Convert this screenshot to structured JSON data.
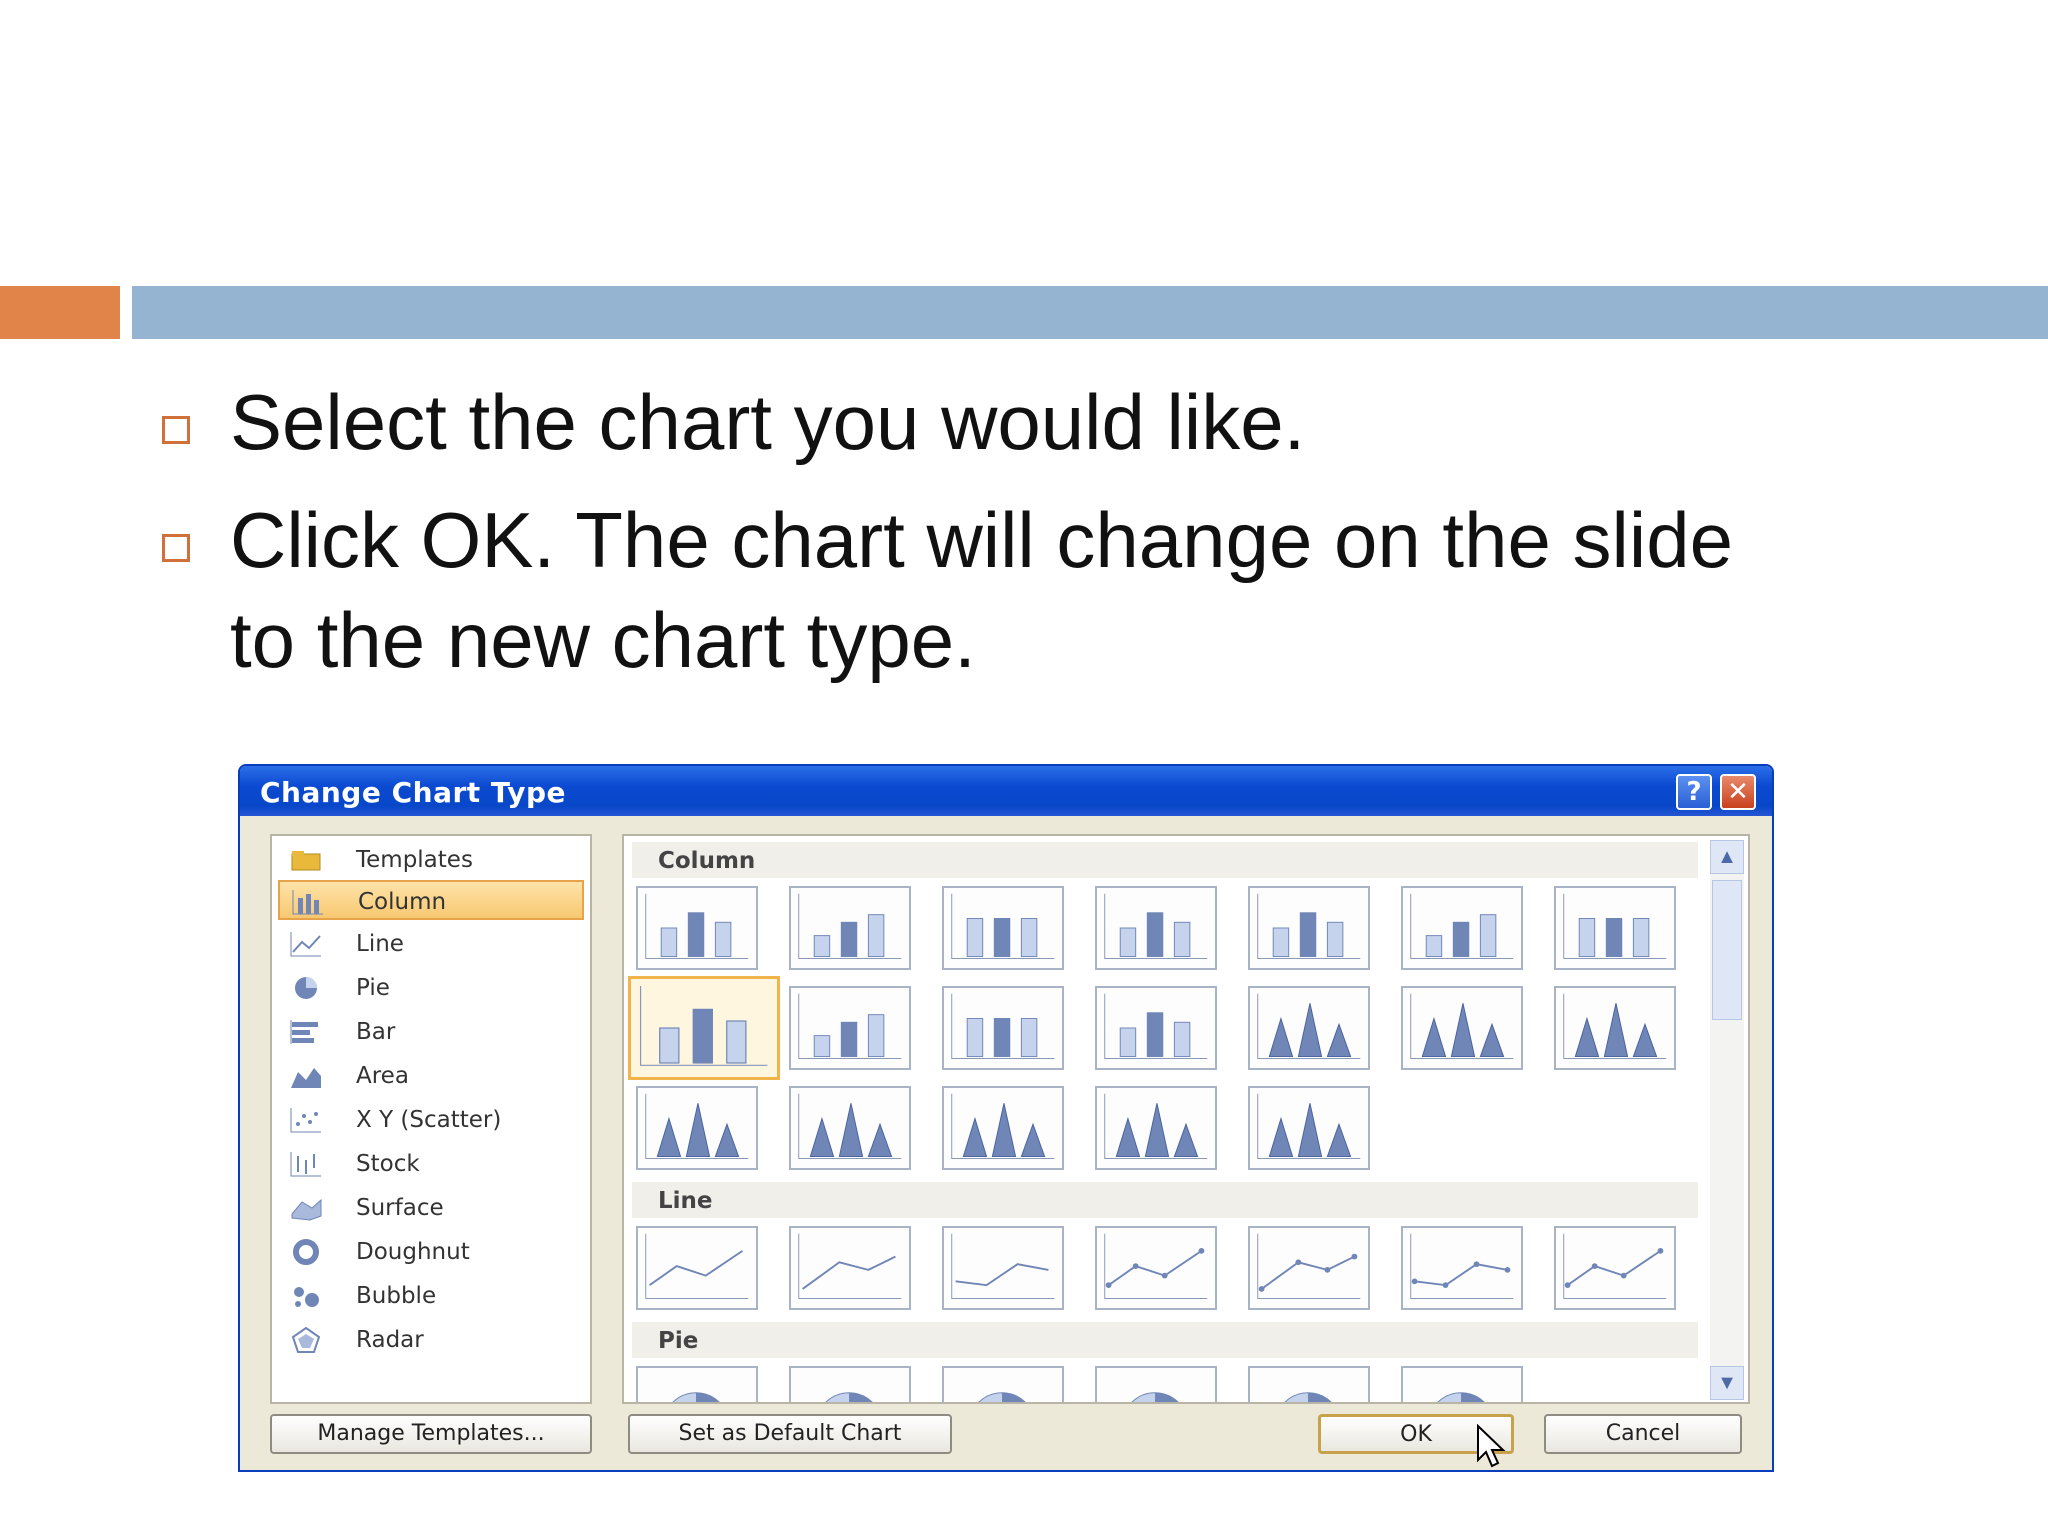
{
  "slide": {
    "bullets": [
      "Select the chart you would like.",
      "Click OK. The chart will change on the slide",
      "to the new chart type."
    ],
    "colors": {
      "accent_orange": "#e0844a",
      "accent_blue": "#94b4d2"
    }
  },
  "dialog": {
    "title": "Change Chart Type",
    "help_glyph": "?",
    "close_glyph": "✕",
    "types": [
      {
        "label": "Templates",
        "icon": "folder-icon"
      },
      {
        "label": "Column",
        "icon": "column-chart-icon",
        "selected": true
      },
      {
        "label": "Line",
        "icon": "line-chart-icon"
      },
      {
        "label": "Pie",
        "icon": "pie-chart-icon"
      },
      {
        "label": "Bar",
        "icon": "bar-chart-icon"
      },
      {
        "label": "Area",
        "icon": "area-chart-icon"
      },
      {
        "label": "X Y (Scatter)",
        "icon": "scatter-chart-icon"
      },
      {
        "label": "Stock",
        "icon": "stock-chart-icon"
      },
      {
        "label": "Surface",
        "icon": "surface-chart-icon"
      },
      {
        "label": "Doughnut",
        "icon": "doughnut-chart-icon"
      },
      {
        "label": "Bubble",
        "icon": "bubble-chart-icon"
      },
      {
        "label": "Radar",
        "icon": "radar-chart-icon"
      }
    ],
    "sections": [
      "Column",
      "Line",
      "Pie"
    ],
    "buttons": {
      "manage_templates": "Manage Templates...",
      "set_default": "Set as Default Chart",
      "ok": "OK",
      "cancel": "Cancel"
    }
  }
}
